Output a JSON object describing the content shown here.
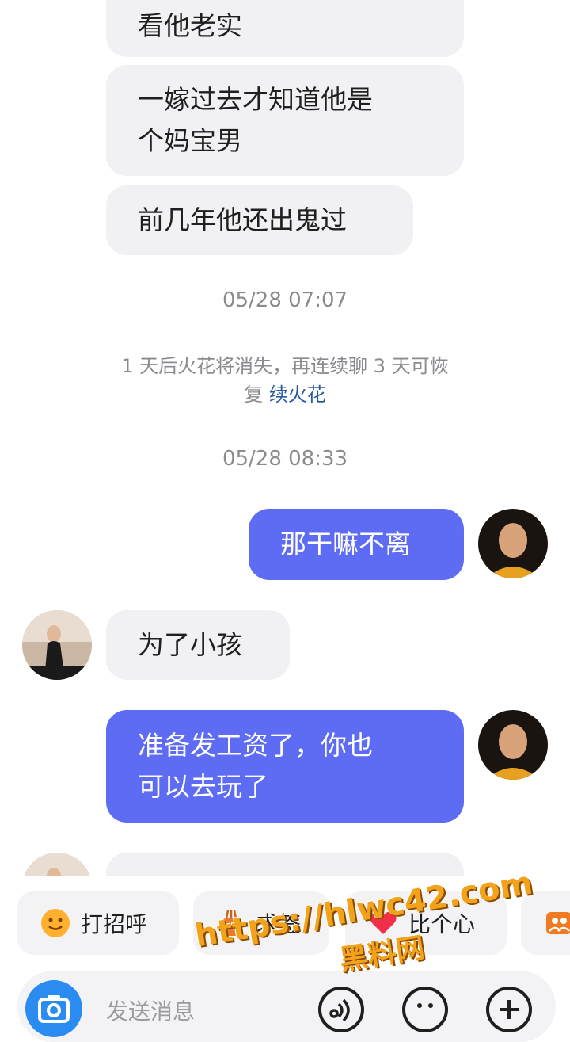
{
  "messages": {
    "m1": "看他老实",
    "m2_line1": "一嫁过去才知道他是",
    "m2_line2": "个妈宝男",
    "m3": "前几年他还出鬼过",
    "m4": "那干嘛不离",
    "m5": "为了小孩",
    "m6_line1": "准备发工资了，你也",
    "m6_line2": "可以去玩了"
  },
  "timestamps": {
    "t1": "05/28 07:07",
    "t2": "05/28 08:33"
  },
  "notice": {
    "line1": "1 天后火花将消失，再连续聊 3 天可恢",
    "line2_prefix": "复 ",
    "link": "续火花"
  },
  "quick_replies": {
    "greet": "打招呼",
    "ask": "求签",
    "heart": "比个心"
  },
  "composer": {
    "placeholder": "发送消息"
  },
  "watermark": {
    "url": "https://hlwc42.com",
    "site": "黑料网"
  },
  "colors": {
    "outgoing": "#5d6cf3",
    "incoming": "#f1f1f4",
    "link": "#2a5a9e",
    "camera": "#2a8cf0"
  },
  "icons": [
    "camera-icon",
    "voice-icon",
    "emoji-icon",
    "plus-icon",
    "smile-icon",
    "fortune-icon",
    "heart-icon",
    "group-icon"
  ]
}
